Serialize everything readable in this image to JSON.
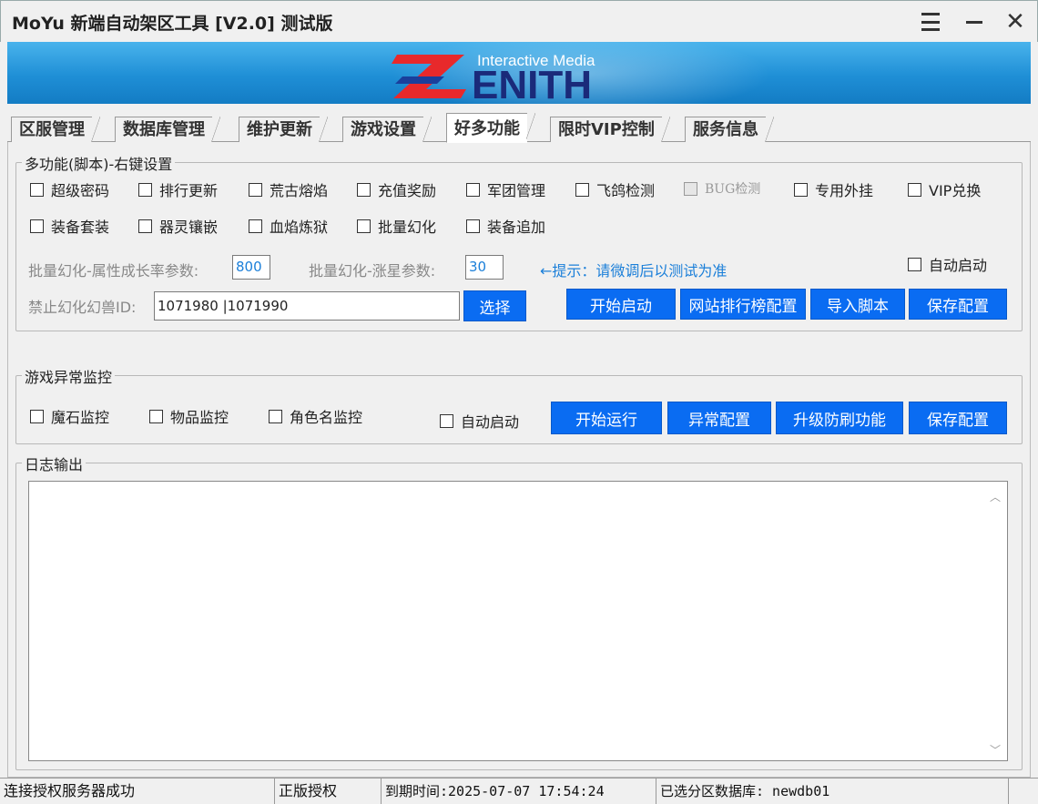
{
  "window": {
    "title": "MoYu 新端自动架区工具 [V2.0] 测试版"
  },
  "banner": {
    "tagline": "Interactive Media",
    "brand": "ENITH"
  },
  "tabs": [
    {
      "label": "区服管理",
      "active": false
    },
    {
      "label": "数据库管理",
      "active": false
    },
    {
      "label": "维护更新",
      "active": false
    },
    {
      "label": "游戏设置",
      "active": false
    },
    {
      "label": "好多功能",
      "active": true
    },
    {
      "label": "限时VIP控制",
      "active": false
    },
    {
      "label": "服务信息",
      "active": false
    }
  ],
  "multi": {
    "title": "多功能(脚本)-右键设置",
    "checkboxes": [
      {
        "label": "超级密码",
        "checked": false
      },
      {
        "label": "排行更新",
        "checked": false
      },
      {
        "label": "荒古熔焰",
        "checked": false
      },
      {
        "label": "充值奖励",
        "checked": false
      },
      {
        "label": "军团管理",
        "checked": false
      },
      {
        "label": "飞鸽检测",
        "checked": false
      },
      {
        "label": "BUG检测",
        "checked": false,
        "disabled": true
      },
      {
        "label": "专用外挂",
        "checked": false
      },
      {
        "label": "VIP兑换",
        "checked": false
      },
      {
        "label": "装备套装",
        "checked": false
      },
      {
        "label": "器灵镶嵌",
        "checked": false
      },
      {
        "label": "血焰炼狱",
        "checked": false
      },
      {
        "label": "批量幻化",
        "checked": false
      },
      {
        "label": "装备追加",
        "checked": false
      }
    ],
    "growth_label": "批量幻化-属性成长率参数:",
    "growth_value": "800",
    "star_label": "批量幻化-涨星参数:",
    "star_value": "30",
    "hint": "←提示：请微调后以测试为准",
    "auto_start": "自动启动",
    "ban_label": "禁止幻化幻兽ID:",
    "ban_value": "1071980 |1071990",
    "select_btn": "选择",
    "start_btn": "开始启动",
    "rank_btn": "网站排行榜配置",
    "import_btn": "导入脚本",
    "save_btn": "保存配置"
  },
  "monitor": {
    "title": "游戏异常监控",
    "checkboxes": [
      {
        "label": "魔石监控",
        "checked": false
      },
      {
        "label": "物品监控",
        "checked": false
      },
      {
        "label": "角色名监控",
        "checked": false
      }
    ],
    "auto_start": "自动启动",
    "run_btn": "开始运行",
    "config_btn": "异常配置",
    "upgrade_btn": "升级防刷功能",
    "save_btn": "保存配置"
  },
  "log": {
    "title": "日志输出",
    "content": ""
  },
  "status": {
    "connection": "连接授权服务器成功",
    "license": "正版授权",
    "expiry": "到期时间:2025-07-07 17:54:24",
    "database": "已选分区数据库: newdb01"
  }
}
